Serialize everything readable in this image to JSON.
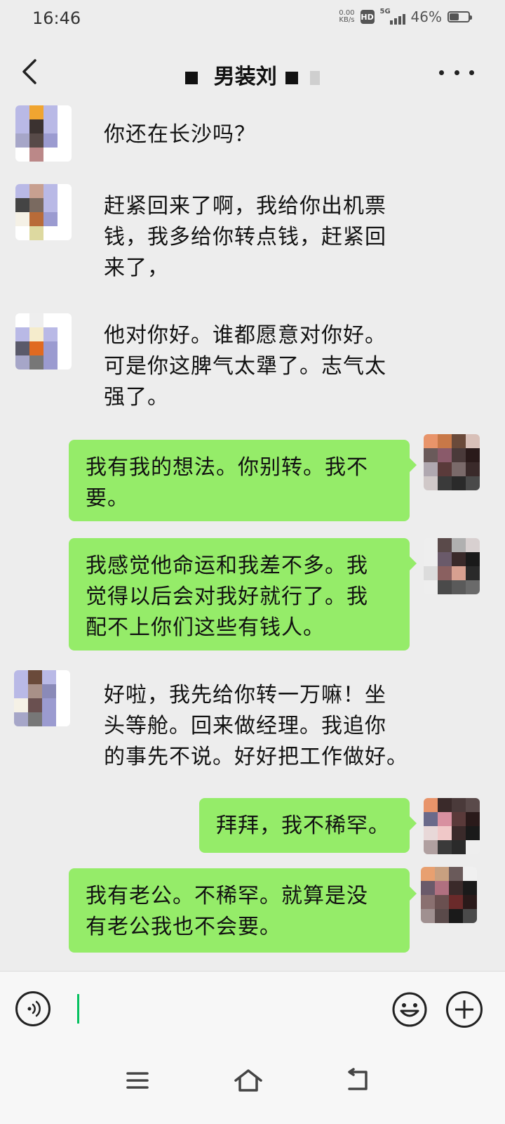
{
  "status_bar": {
    "time": "16:46",
    "net_speed_value": "0.00",
    "net_speed_unit": "KB/s",
    "hd": "HD",
    "network": "5G",
    "battery": "46%",
    "battery_level": 0.46
  },
  "header": {
    "title": "男装刘"
  },
  "messages": [
    {
      "side": "left",
      "text": "你还在长沙吗？"
    },
    {
      "side": "left",
      "text": "赶紧回来了啊，我给你出机票\n钱，我多给你转点钱，赶紧回\n来了，"
    },
    {
      "side": "left",
      "text": "他对你好。谁都愿意对你好。\n可是你这脾气太犟了。志气太\n强了。"
    },
    {
      "side": "right",
      "text": "我有我的想法。你别转。我不\n要。"
    },
    {
      "side": "right",
      "text": "我感觉他命运和我差不多。我\n觉得以后会对我好就行了。我\n配不上你们这些有钱人。"
    },
    {
      "side": "left",
      "text": "好啦，我先给你转一万嘛！坐\n头等舱。回来做经理。我追你\n的事先不说。好好把工作做好。"
    },
    {
      "side": "right",
      "text": "拜拜，我不稀罕。"
    },
    {
      "side": "right",
      "text": "我有老公。不稀罕。就算是没\n有老公我也不会要。"
    }
  ],
  "colors": {
    "background": "#ededed",
    "bubble_self": "#95ec69",
    "caret": "#07c160"
  },
  "icons": {
    "back": "chevron-left-icon",
    "more": "more-dots-icon",
    "voice": "voice-icon",
    "emoji": "emoji-icon",
    "plus": "plus-icon",
    "sys_menu": "menu-icon",
    "sys_home": "home-icon",
    "sys_back": "back-icon"
  }
}
